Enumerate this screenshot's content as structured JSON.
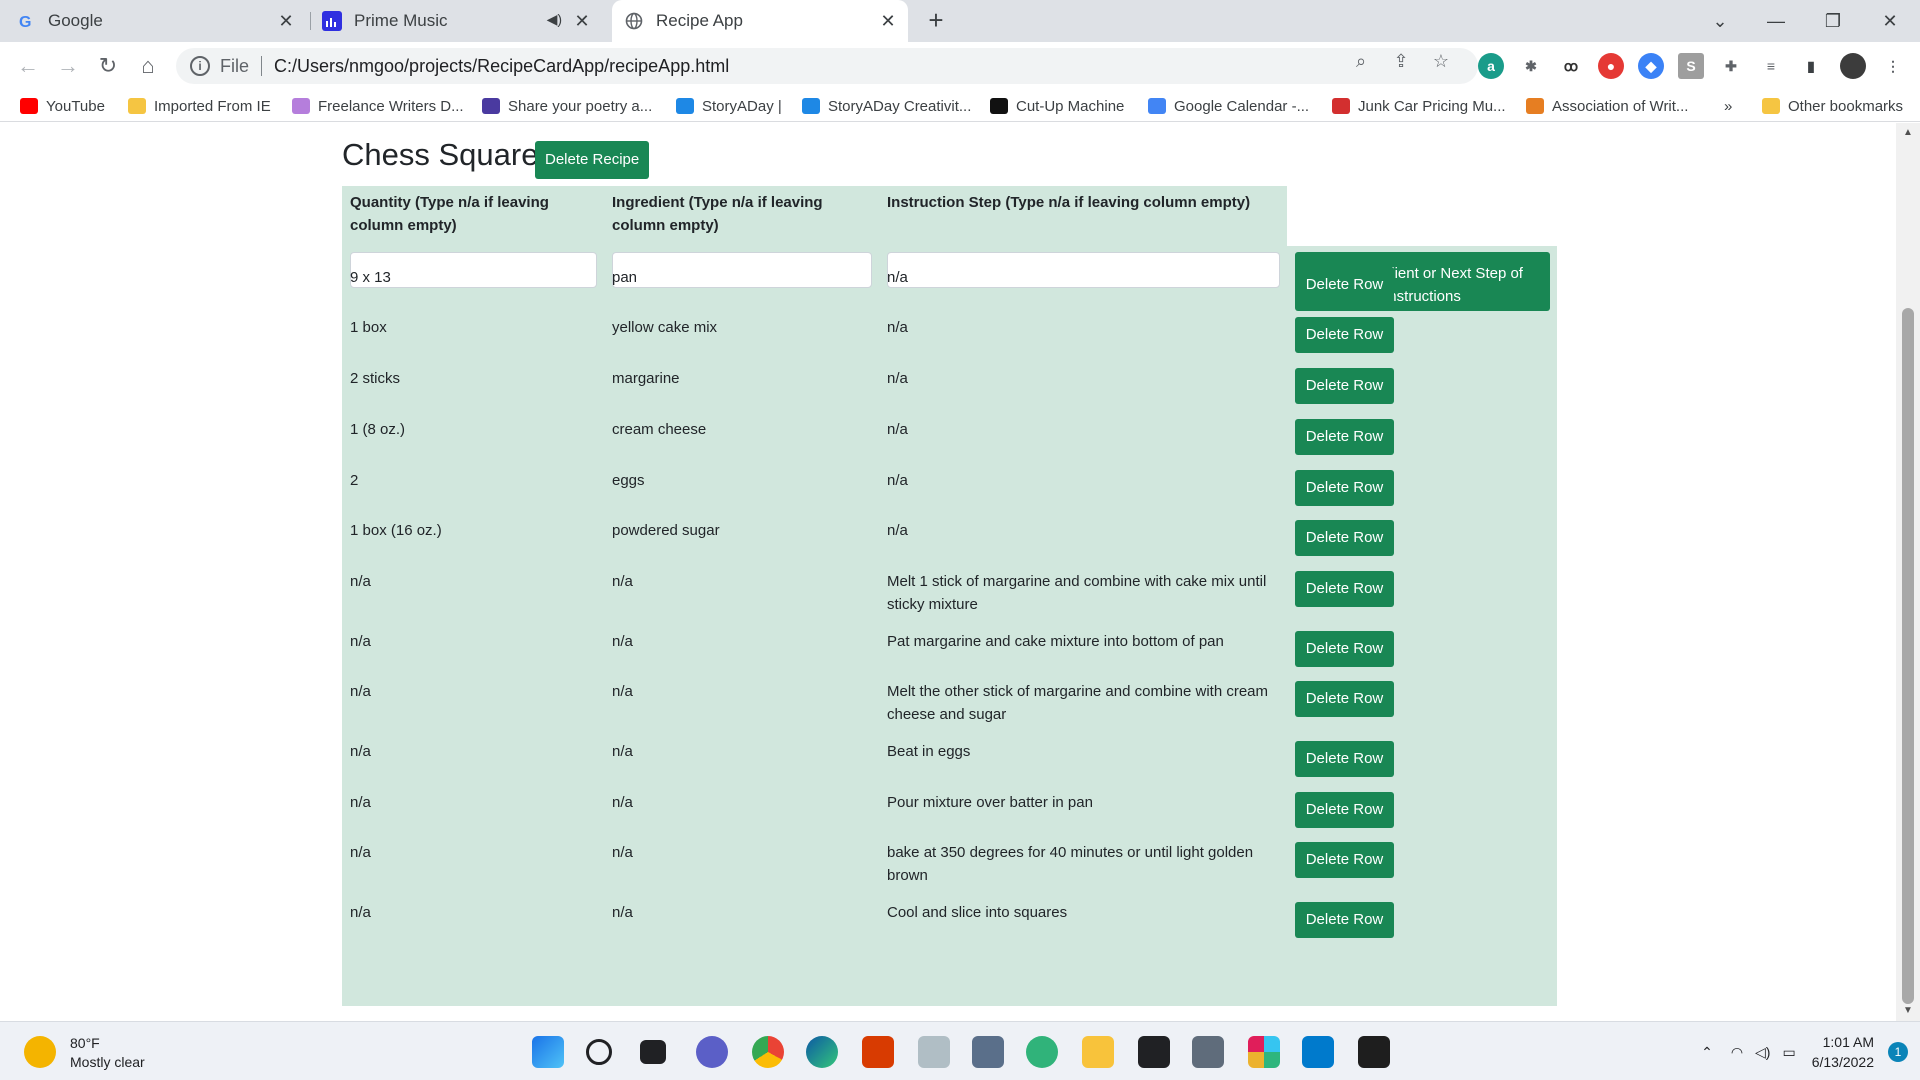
{
  "browser": {
    "tabs": [
      {
        "title": "Google",
        "favicon": "google-icon"
      },
      {
        "title": "Prime Music",
        "favicon": "prime-music-icon"
      },
      {
        "title": "Recipe App",
        "favicon": "globe-icon",
        "active": true
      }
    ],
    "address": {
      "scheme": "File",
      "url": "C:/Users/nmgoo/projects/RecipeCardApp/recipeApp.html"
    },
    "bookmarks": [
      {
        "label": "YouTube",
        "icon": "youtube-icon",
        "color": "#ff0000"
      },
      {
        "label": "Imported From IE",
        "icon": "folder-icon",
        "color": "#f5c542"
      },
      {
        "label": "Freelance Writers D...",
        "icon": "d-icon",
        "color": "#b57edc"
      },
      {
        "label": "Share your poetry a...",
        "icon": "book-icon",
        "color": "#4a3aa0"
      },
      {
        "label": "StoryADay |",
        "icon": "storyaday-icon",
        "color": "#1e88e5"
      },
      {
        "label": "StoryADay Creativit...",
        "icon": "storyaday-icon",
        "color": "#1e88e5"
      },
      {
        "label": "Cut-Up Machine",
        "icon": "cutup-icon",
        "color": "#111111"
      },
      {
        "label": "Google Calendar -...",
        "icon": "calendar-icon",
        "color": "#4285f4"
      },
      {
        "label": "Junk Car Pricing Mu...",
        "icon": "tn-icon",
        "color": "#d32f2f"
      },
      {
        "label": "Association of Writ...",
        "icon": "awp-icon",
        "color": "#e67e22"
      }
    ],
    "more_bookmarks": "»",
    "other_bookmarks": "Other bookmarks"
  },
  "recipe": {
    "title": "Chess Squares",
    "delete_recipe_label": "Delete Recipe",
    "headers": {
      "quantity": "Quantity (Type n/a if leaving column empty)",
      "ingredient": "Ingredient (Type n/a if leaving column empty)",
      "instruction": "Instruction Step (Type n/a if leaving column empty)"
    },
    "inputs": {
      "quantity": "",
      "ingredient": "",
      "instruction": ""
    },
    "add_label": "Add ingredient or Next Step of Instructions",
    "delete_row_label": "Delete Row",
    "rows": [
      {
        "quantity": "9 x 13",
        "ingredient": "pan",
        "instruction": "n/a"
      },
      {
        "quantity": "1 box",
        "ingredient": "yellow cake mix",
        "instruction": "n/a"
      },
      {
        "quantity": "2 sticks",
        "ingredient": "margarine",
        "instruction": "n/a"
      },
      {
        "quantity": "1 (8 oz.)",
        "ingredient": "cream cheese",
        "instruction": "n/a"
      },
      {
        "quantity": "2",
        "ingredient": "eggs",
        "instruction": "n/a"
      },
      {
        "quantity": "1 box (16 oz.)",
        "ingredient": "powdered sugar",
        "instruction": "n/a"
      },
      {
        "quantity": "n/a",
        "ingredient": "n/a",
        "instruction": "Melt 1 stick of margarine and combine with cake mix until sticky mixture"
      },
      {
        "quantity": "n/a",
        "ingredient": "n/a",
        "instruction": "Pat margarine and cake mixture into bottom of pan"
      },
      {
        "quantity": "n/a",
        "ingredient": "n/a",
        "instruction": "Melt the other stick of margarine and combine with cream cheese and sugar"
      },
      {
        "quantity": "n/a",
        "ingredient": "n/a",
        "instruction": "Beat in eggs"
      },
      {
        "quantity": "n/a",
        "ingredient": "n/a",
        "instruction": "Pour mixture over batter in pan"
      },
      {
        "quantity": "n/a",
        "ingredient": "n/a",
        "instruction": "bake at 350 degrees for 40 minutes or until light golden brown"
      },
      {
        "quantity": "n/a",
        "ingredient": "n/a",
        "instruction": "Cool and slice into squares"
      }
    ]
  },
  "taskbar": {
    "weather": {
      "temp": "80°F",
      "condition": "Mostly clear"
    },
    "time": "1:01 AM",
    "date": "6/13/2022",
    "notifications": "1"
  },
  "colors": {
    "accent": "#198754",
    "table_bg": "#d1e7dd"
  }
}
